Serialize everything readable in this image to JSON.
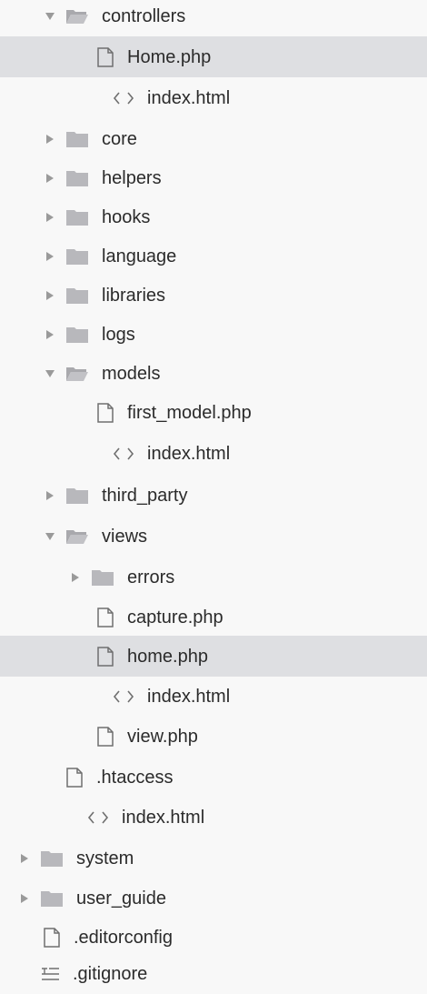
{
  "colors": {
    "background": "#f8f8f8",
    "selected_row": "#dedfe2",
    "folder_fill": "#b8b8bc",
    "icon_stroke": "#6f6f6f",
    "text": "#2b2b2b"
  },
  "tree": {
    "items": [
      {
        "label": "controllers",
        "icon": "folder-open-icon",
        "caret": "expanded"
      },
      {
        "label": "Home.php",
        "icon": "file-icon",
        "selected": true
      },
      {
        "label": "index.html",
        "icon": "code-icon"
      },
      {
        "label": "core",
        "icon": "folder-icon",
        "caret": "collapsed"
      },
      {
        "label": "helpers",
        "icon": "folder-icon",
        "caret": "collapsed"
      },
      {
        "label": "hooks",
        "icon": "folder-icon",
        "caret": "collapsed"
      },
      {
        "label": "language",
        "icon": "folder-icon",
        "caret": "collapsed"
      },
      {
        "label": "libraries",
        "icon": "folder-icon",
        "caret": "collapsed"
      },
      {
        "label": "logs",
        "icon": "folder-icon",
        "caret": "collapsed"
      },
      {
        "label": "models",
        "icon": "folder-open-icon",
        "caret": "expanded"
      },
      {
        "label": "first_model.php",
        "icon": "file-icon"
      },
      {
        "label": "index.html",
        "icon": "code-icon"
      },
      {
        "label": "third_party",
        "icon": "folder-icon",
        "caret": "collapsed"
      },
      {
        "label": "views",
        "icon": "folder-open-icon",
        "caret": "expanded"
      },
      {
        "label": "errors",
        "icon": "folder-icon",
        "caret": "collapsed"
      },
      {
        "label": "capture.php",
        "icon": "file-icon"
      },
      {
        "label": "home.php",
        "icon": "file-icon",
        "selected": true
      },
      {
        "label": "index.html",
        "icon": "code-icon"
      },
      {
        "label": "view.php",
        "icon": "file-icon"
      },
      {
        "label": ".htaccess",
        "icon": "file-icon"
      },
      {
        "label": "index.html",
        "icon": "code-icon"
      },
      {
        "label": "system",
        "icon": "folder-icon",
        "caret": "collapsed"
      },
      {
        "label": "user_guide",
        "icon": "folder-icon",
        "caret": "collapsed"
      },
      {
        "label": ".editorconfig",
        "icon": "file-icon"
      },
      {
        "label": ".gitignore",
        "icon": "list-icon"
      }
    ]
  }
}
